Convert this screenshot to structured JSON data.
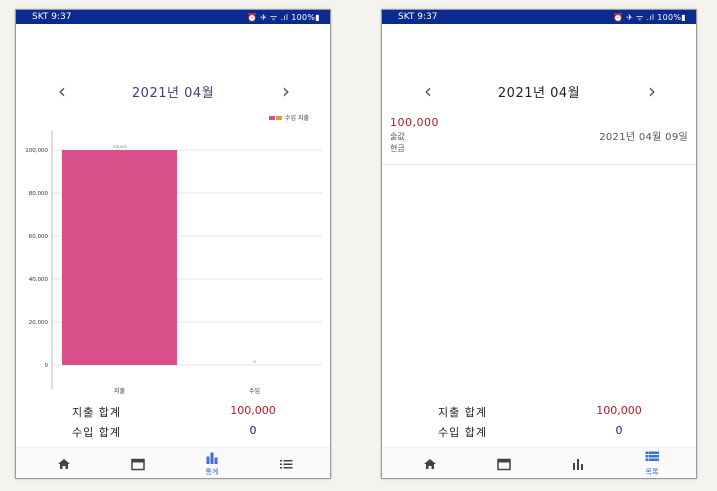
{
  "status_bar": {
    "carrier_time": "SKT 9:37",
    "indicators": "⏰ ✈ ᯤ .ıl 100%▮"
  },
  "month_nav": {
    "prev": "‹",
    "month": "2021년 04월",
    "next": "›"
  },
  "chart_data": {
    "type": "bar",
    "categories": [
      "지출",
      "수입"
    ],
    "series": [
      {
        "name": "수입 지출",
        "values": [
          100000,
          0
        ]
      }
    ],
    "legend_label": "수입 지출",
    "value_labels": [
      "100,000",
      "0"
    ],
    "ylim": [
      0,
      100000
    ],
    "yticks": [
      "0",
      "20,000",
      "40,000",
      "60,000",
      "80,000",
      "100,000"
    ],
    "grid": true,
    "legend_position": "top-right",
    "colors": {
      "expense": "#d94f8a",
      "income": "#e69a3c"
    }
  },
  "totals": {
    "expense_label": "지출 합계",
    "expense_value": "100,000",
    "income_label": "수입 합계",
    "income_value": "0"
  },
  "bottom_nav": {
    "left_active_label": "통계",
    "right_active_label": "목록"
  },
  "list": {
    "entries": [
      {
        "amount": "100,000",
        "category": "술값",
        "method": "현금",
        "date": "2021년 04월 09일"
      }
    ]
  }
}
